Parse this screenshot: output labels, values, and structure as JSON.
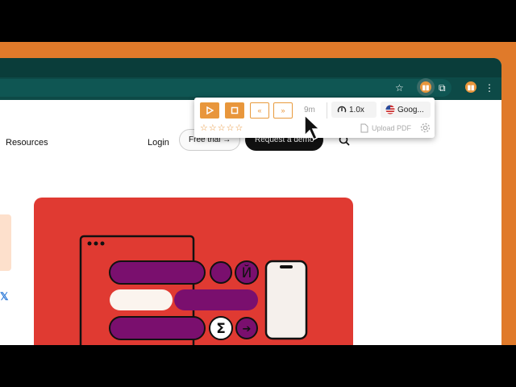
{
  "nav": {
    "resources": "Resources",
    "login": "Login",
    "free_trial": "Free trial",
    "request_demo": "Request a demo"
  },
  "popup": {
    "speed": "1.0x",
    "voice": "Goog...",
    "time": "9m",
    "upload": "Upload PDF",
    "stars": "☆☆☆☆☆"
  },
  "icons": {
    "star": "☆",
    "x": "𝕏",
    "menu": "⋮",
    "puzzle": "⧉"
  },
  "hero": {
    "glyph_cyrillic": "Й",
    "glyph_sigma": "Σ",
    "glyph_arrow": "➔"
  },
  "colors": {
    "accent": "#e8963c",
    "hero_bg": "#e03a32",
    "purple": "#7a0f6e",
    "chrome": "#0d4a47"
  }
}
